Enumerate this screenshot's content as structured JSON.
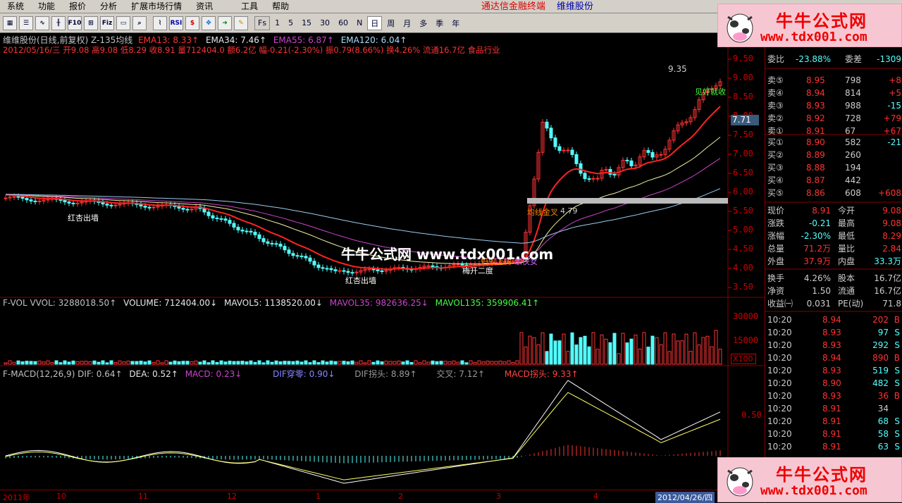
{
  "menu": {
    "items": [
      "系统",
      "功能",
      "报价",
      "分析",
      "扩展市场行情",
      "资讯",
      "工具",
      "帮助"
    ],
    "title_app": "通达信金融终端",
    "title_stock": "维维股份"
  },
  "toolbar": {
    "periods": [
      "Fs",
      "1",
      "5",
      "15",
      "30",
      "60",
      "N",
      "日",
      "周",
      "月",
      "多",
      "季",
      "年"
    ],
    "active_period": "日"
  },
  "main_chart": {
    "header_line1": [
      {
        "text": "维维股份(日线,前复权) Z-135均线",
        "color": "#c0c0c0"
      },
      {
        "text": "EMA13: 8.33↑",
        "color": "#ff3333"
      },
      {
        "text": "EMA34: 7.46↑",
        "color": "#e8e8e8"
      },
      {
        "text": "EMA55: 6.87↑",
        "color": "#cc44cc"
      },
      {
        "text": "EMA120: 6.04↑",
        "color": "#aaddff"
      }
    ],
    "header_line2": "2012/05/16/三 开9.08 高9.08 低8.29 收8.91 量712404.0 额6.2亿 幅-0.21(-2.30%) 振0.79(8.66%) 换4.26% 流通16.7亿 食品行业",
    "y_labels": [
      "9.50",
      "9.00",
      "8.50",
      "8.00",
      "7.50",
      "7.00",
      "6.50",
      "6.00",
      "5.50",
      "5.00",
      "4.50",
      "4.00",
      "3.50"
    ],
    "current_price_tag": "7.71",
    "annotations": [
      {
        "text": "红杏出墙",
        "color": "#ffffff"
      },
      {
        "text": "红杏出墙",
        "color": "#ffffff"
      },
      {
        "text": "梅开二度",
        "color": "#ffffff"
      },
      {
        "text": "蚂蚁上树",
        "color": "#ff8800"
      },
      {
        "text": "依侠女",
        "color": "#cc66ff"
      },
      {
        "text": "均线金叉",
        "color": "#ff8800"
      },
      {
        "text": "见好就收",
        "color": "#44ff44"
      },
      {
        "text": "9.35",
        "color": "#cccccc"
      },
      {
        "text": "4.79",
        "color": "#cccccc"
      }
    ]
  },
  "volume_chart": {
    "header": [
      {
        "text": "F-VOL VVOL: 3288018.50↑",
        "color": "#c0c0c0"
      },
      {
        "text": "VOLUME: 712404.00↓",
        "color": "#e8e8e8"
      },
      {
        "text": "MAVOL5: 1138520.00↓",
        "color": "#e8e8e8"
      },
      {
        "text": "MAVOL35: 982636.25↓",
        "color": "#cc44cc"
      },
      {
        "text": "MAVOL135: 359906.41↑",
        "color": "#44ff44"
      }
    ],
    "y_labels": [
      "30000",
      "15000"
    ],
    "multiplier": "X100"
  },
  "macd_chart": {
    "header": [
      {
        "text": "F-MACD(12,26,9) DIF: 0.64↑",
        "color": "#c0c0c0"
      },
      {
        "text": "DEA: 0.52↑",
        "color": "#e8e8e8"
      },
      {
        "text": "MACD: 0.23↓",
        "color": "#cc44cc"
      },
      {
        "text": "DIF穿零: 0.90↓",
        "color": "#8888ff"
      },
      {
        "text": "DIF拐头: 8.89↑",
        "color": "#999999"
      },
      {
        "text": "交叉: 7.12↑",
        "color": "#999999"
      },
      {
        "text": "MACD拐头: 9.33↑",
        "color": "#ff4444"
      }
    ],
    "y_labels": [
      "0.50"
    ]
  },
  "date_axis": [
    "2011年",
    "10",
    "11",
    "12",
    "1",
    "2",
    "3",
    "4",
    "2012/04/26/四"
  ],
  "quote_panel": {
    "wei": {
      "label1": "委比",
      "val1": "-23.88%",
      "label2": "委差",
      "val2": "-1309"
    },
    "asks": [
      {
        "label": "卖⑤",
        "price": "8.95",
        "vol": "798",
        "chg": "+8"
      },
      {
        "label": "卖④",
        "price": "8.94",
        "vol": "814",
        "chg": "+5"
      },
      {
        "label": "卖③",
        "price": "8.93",
        "vol": "988",
        "chg": "-15"
      },
      {
        "label": "卖②",
        "price": "8.92",
        "vol": "728",
        "chg": "+79"
      },
      {
        "label": "卖①",
        "price": "8.91",
        "vol": "67",
        "chg": "+67"
      }
    ],
    "bids": [
      {
        "label": "买①",
        "price": "8.90",
        "vol": "582",
        "chg": "-21"
      },
      {
        "label": "买②",
        "price": "8.89",
        "vol": "260",
        "chg": ""
      },
      {
        "label": "买③",
        "price": "8.88",
        "vol": "194",
        "chg": ""
      },
      {
        "label": "买④",
        "price": "8.87",
        "vol": "442",
        "chg": ""
      },
      {
        "label": "买⑤",
        "price": "8.86",
        "vol": "608",
        "chg": "+608"
      }
    ],
    "stats": [
      {
        "l1": "现价",
        "v1": "8.91",
        "l2": "今开",
        "v2": "9.08"
      },
      {
        "l1": "涨跌",
        "v1": "-0.21",
        "l2": "最高",
        "v2": "9.08"
      },
      {
        "l1": "涨幅",
        "v1": "-2.30%",
        "l2": "最低",
        "v2": "8.29"
      },
      {
        "l1": "总量",
        "v1": "71.2万",
        "l2": "量比",
        "v2": "2.84"
      },
      {
        "l1": "外盘",
        "v1": "37.9万",
        "l2": "内盘",
        "v2": "33.3万"
      }
    ],
    "stats2": [
      {
        "l1": "换手",
        "v1": "4.26%",
        "l2": "股本",
        "v2": "16.7亿"
      },
      {
        "l1": "净资",
        "v1": "1.50",
        "l2": "流通",
        "v2": "16.7亿"
      },
      {
        "l1": "收益㈠",
        "v1": "0.031",
        "l2": "PE(动)",
        "v2": "71.8"
      }
    ],
    "ticks": [
      {
        "time": "10:20",
        "price": "8.94",
        "vol": "202",
        "side": "B"
      },
      {
        "time": "10:20",
        "price": "8.93",
        "vol": "97",
        "side": "S"
      },
      {
        "time": "10:20",
        "price": "8.93",
        "vol": "292",
        "side": "S"
      },
      {
        "time": "10:20",
        "price": "8.94",
        "vol": "890",
        "side": "B"
      },
      {
        "time": "10:20",
        "price": "8.93",
        "vol": "519",
        "side": "S"
      },
      {
        "time": "10:20",
        "price": "8.90",
        "vol": "482",
        "side": "S"
      },
      {
        "time": "10:20",
        "price": "8.93",
        "vol": "36",
        "side": "B"
      },
      {
        "time": "10:20",
        "price": "8.91",
        "vol": "34",
        "side": ""
      },
      {
        "time": "10:20",
        "price": "8.91",
        "vol": "68",
        "side": "S"
      },
      {
        "time": "10:20",
        "price": "8.91",
        "vol": "58",
        "side": "S"
      },
      {
        "time": "10:20",
        "price": "8.91",
        "vol": "63",
        "side": "S"
      }
    ]
  },
  "watermark": {
    "center": "牛牛公式网 www.tdx001.com",
    "badge_line1": "牛牛公式网",
    "badge_line2": "www.tdx001.com"
  },
  "colors": {
    "up": "#ff3333",
    "down": "#54ffff",
    "panel_border": "#880000",
    "ema13": "#ff2222",
    "ema34": "#f0f0a0",
    "ema55": "#cc44cc",
    "ema120": "#99ccee"
  }
}
